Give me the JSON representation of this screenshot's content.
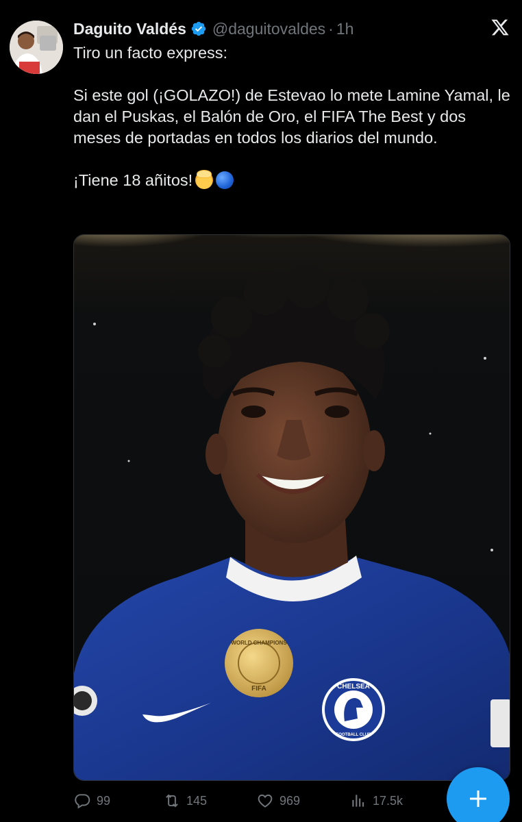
{
  "tweet": {
    "author_name": "Daguito Valdés",
    "author_handle": "@daguitovaldes",
    "separator": "·",
    "time": "1h",
    "paragraphs": [
      "Tiro un facto express:",
      "Si este gol (¡GOLAZO!) de Estevao lo mete Lamine Yamal, le dan el Puskas, el Balón de Oro, el FIFA The Best y dos meses de portadas en todos los diarios del mundo.",
      "¡Tiene 18 añitos!"
    ],
    "emojis": [
      "exploding-head-emoji",
      "blue-circle-emoji"
    ],
    "image": {
      "badge_text": "WORLD CHAMPIONS",
      "badge_sub": "FIFA",
      "crest_text": "CHELSEA",
      "crest_sub": "FOOTBALL CLUB"
    }
  },
  "actions": {
    "replies": "99",
    "reposts": "145",
    "likes": "969",
    "views": "17.5k"
  },
  "colors": {
    "background": "#000000",
    "text": "#e7e9ea",
    "muted": "#71767b",
    "accent": "#1d9bf0",
    "jersey": "#1a3c9e"
  },
  "icons": [
    "x-logo-icon",
    "verified-badge-icon",
    "reply-icon",
    "repost-icon",
    "like-icon",
    "views-icon",
    "compose-plus-icon"
  ]
}
